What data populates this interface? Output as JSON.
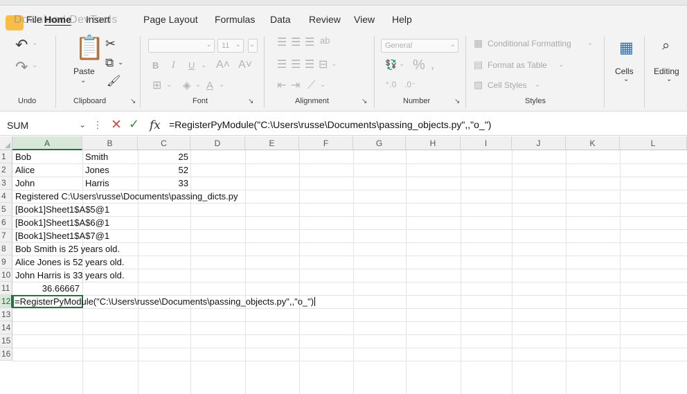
{
  "watermark": "Download DevTools",
  "menu_tabs": [
    {
      "label": "File"
    },
    {
      "label": "Home"
    },
    {
      "label": "Insert"
    },
    {
      "label": "Page Layout"
    },
    {
      "label": "Formulas"
    },
    {
      "label": "Data"
    },
    {
      "label": "Review"
    },
    {
      "label": "View"
    },
    {
      "label": "Help"
    }
  ],
  "ribbon": {
    "groups": {
      "undo": "Undo",
      "clipboard": "Clipboard",
      "font": "Font",
      "alignment": "Alignment",
      "number": "Number",
      "styles": "Styles"
    },
    "paste_label": "Paste",
    "font_size": "11",
    "number_format": "General",
    "conditional_formatting": "Conditional Formatting",
    "format_as_table": "Format as Table",
    "cell_styles": "Cell Styles",
    "cells": "Cells",
    "editing": "Editing"
  },
  "formula_bar": {
    "name_box": "SUM",
    "formula": "=RegisterPyModule(\"C:\\Users\\russe\\Documents\\passing_objects.py\",,\"o_\")"
  },
  "columns": [
    "A",
    "B",
    "C",
    "D",
    "E",
    "F",
    "G",
    "H",
    "I",
    "J",
    "K",
    "L"
  ],
  "rows": [
    "1",
    "2",
    "3",
    "4",
    "5",
    "6",
    "7",
    "8",
    "9",
    "10",
    "11",
    "12",
    "13",
    "14",
    "15",
    "16"
  ],
  "cells": {
    "r1": {
      "a": "Bob",
      "b": "Smith",
      "c": "25"
    },
    "r2": {
      "a": "Alice",
      "b": "Jones",
      "c": "52"
    },
    "r3": {
      "a": "John",
      "b": "Harris",
      "c": "33"
    },
    "r4": {
      "a": "Registered C:\\Users\\russe\\Documents\\passing_dicts.py"
    },
    "r5": {
      "a": "[Book1]Sheet1$A$5@1"
    },
    "r6": {
      "a": "[Book1]Sheet1$A$6@1"
    },
    "r7": {
      "a": "[Book1]Sheet1$A$7@1"
    },
    "r8": {
      "a": "Bob Smith is 25 years old."
    },
    "r9": {
      "a": "Alice Jones is 52 years old."
    },
    "r10": {
      "a": "John Harris is 33 years old."
    },
    "r11": {
      "a": "36.66667"
    },
    "r12": {
      "a": "=RegisterPyModule(\"C:\\Users\\russe\\Documents\\passing_objects.py\",,\"o_\")"
    }
  },
  "colors": {
    "excel_green": "#217346",
    "cancel_red": "#c0504d",
    "enter_green": "#3a8a3a"
  }
}
